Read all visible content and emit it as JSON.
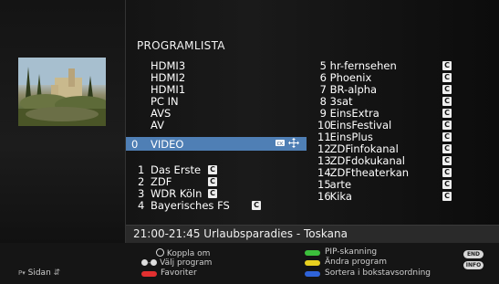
{
  "header": {
    "title": "PROGRAMLISTA"
  },
  "inputs": [
    "HDMI3",
    "HDMI2",
    "HDMI1",
    "PC IN",
    "AVS",
    "AV"
  ],
  "selected": {
    "num": "0",
    "label": "VIDEO"
  },
  "left_channels": [
    {
      "num": "1",
      "name": "Das Erste"
    },
    {
      "num": "2",
      "name": "ZDF"
    },
    {
      "num": "3",
      "name": "WDR Köln"
    },
    {
      "num": "4",
      "name": "Bayerisches FS"
    }
  ],
  "right_channels": [
    {
      "num": "5",
      "name": "hr-fernsehen"
    },
    {
      "num": "6",
      "name": "Phoenix"
    },
    {
      "num": "7",
      "name": "BR-alpha"
    },
    {
      "num": "8",
      "name": "3sat"
    },
    {
      "num": "9",
      "name": "EinsExtra"
    },
    {
      "num": "10",
      "name": "EinsFestival"
    },
    {
      "num": "11",
      "name": "EinsPlus"
    },
    {
      "num": "12",
      "name": "ZDFinfokanal"
    },
    {
      "num": "13",
      "name": "ZDFdokukanal"
    },
    {
      "num": "14",
      "name": "ZDFtheaterkan"
    },
    {
      "num": "15",
      "name": "arte"
    },
    {
      "num": "16",
      "name": "Kika"
    }
  ],
  "badge_text": "C",
  "program_info": "21:00-21:45 Urlaubsparadies - Toskana",
  "footer": {
    "page": "Sidan",
    "connect": "Koppla om",
    "select_program": "Välj program",
    "favorites": "Favoriter",
    "pip_scan": "PIP-skanning",
    "edit_program": "Ändra program",
    "sort": "Sortera i bokstavsordning",
    "end_key": "END",
    "info_key": "INFO"
  },
  "colors": {
    "selection": "#4f7fb5",
    "red": "#e23030",
    "green": "#3cbf3c",
    "yellow": "#e8d020",
    "blue": "#2f63d8"
  }
}
